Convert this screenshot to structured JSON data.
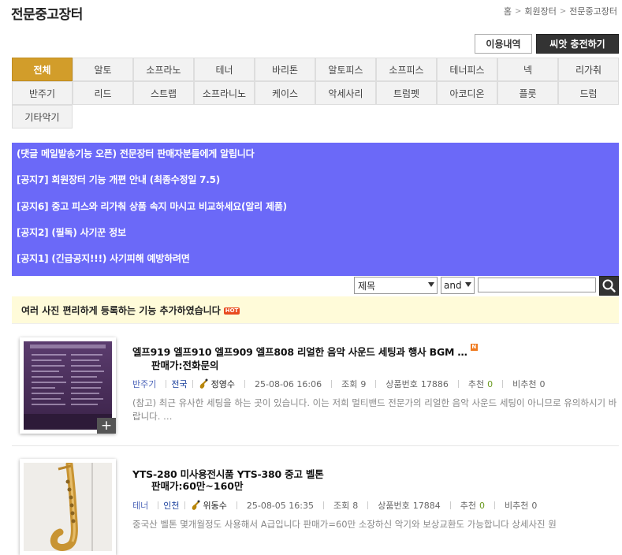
{
  "header": {
    "title": "전문중고장터",
    "breadcrumb": [
      "홈",
      "회원장터",
      "전문중고장터"
    ]
  },
  "top_buttons": {
    "history": "이용내역",
    "charge": "씨앗 충전하기"
  },
  "categories": [
    [
      "전체",
      "알토",
      "소프라노",
      "테너",
      "바리톤",
      "알토피스",
      "소프피스",
      "테너피스",
      "넥",
      "리가춰"
    ],
    [
      "반주기",
      "리드",
      "스트랩",
      "소프라니노",
      "케이스",
      "악세사리",
      "트럼펫",
      "아코디온",
      "플룻",
      "드럼"
    ],
    [
      "기타악기"
    ]
  ],
  "active_category": "전체",
  "notices": [
    "(댓글 메일발송기능 오픈) 전문장터 판매자분들에게 알립니다",
    "[공지7] 회원장터 기능 개편 안내 (최종수정일 7.5)",
    "[공지6] 중고 피스와 리가춰 상품 속지 마시고 비교하세요(알리 제품)",
    "[공지2] (필독) 사기꾼 정보",
    "[공지1] (긴급공지!!!) 사기피해 예방하려면"
  ],
  "search": {
    "field": "제목",
    "operator": "and",
    "value": "",
    "placeholder": ""
  },
  "featured": {
    "text": "여러 사진 편리하게 등록하는 기능 추가하였습니다",
    "badge": "HOT"
  },
  "items": [
    {
      "title": "엘프919 엘프910 엘프909 엘프808 리얼한 음악 사운드 세팅과 행사 BGM …",
      "new_badge": "N",
      "price": "판매가:전화문의",
      "category": "반주기",
      "region": "전국",
      "user": "정영수",
      "date": "25-08-06 16:06",
      "views_label": "조회",
      "views": "9",
      "product_label": "상품번호",
      "product_no": "17886",
      "rec_label": "추천",
      "rec": "0",
      "nonrec_label": "비추천",
      "nonrec": "0",
      "desc": "(참고) 최근 유사한 세팅을 하는 곳이 있습니다. 이는 저희 멀티밴드 전문가의 리얼한 음악 사운드 세팅이 아니므로 유의하시기 바랍니다. …"
    },
    {
      "title": "YTS-280 미사용전시품 YTS-380 중고 벨톤",
      "new_badge": "",
      "price": "판매가:60만~160만",
      "category": "테너",
      "region": "인천",
      "user": "위동수",
      "date": "25-08-05 16:35",
      "views_label": "조회",
      "views": "8",
      "product_label": "상품번호",
      "product_no": "17884",
      "rec_label": "추천",
      "rec": "0",
      "nonrec_label": "비추천",
      "nonrec": "0",
      "desc": "중국산 벨톤 몇개월정도 사용해서 A급입니다 판매가=60만 소장하신 악기와 보상교환도 가능합니다 상세사진 원"
    }
  ],
  "colors": {
    "accent": "#d29d2a",
    "notice_bg": "#6b69f8",
    "featured_bg": "#fffbd9",
    "dark_button": "#333333"
  }
}
